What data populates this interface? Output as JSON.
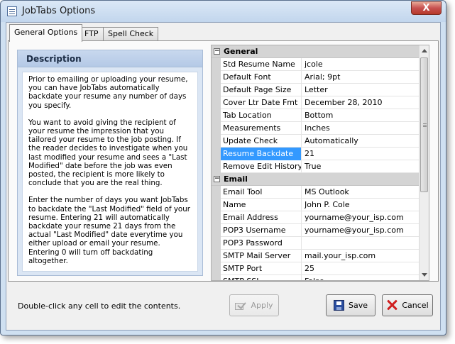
{
  "window": {
    "title": "JobTabs Options",
    "close_label": "X"
  },
  "tabs": [
    {
      "label": "General Options",
      "active": true
    },
    {
      "label": "FTP",
      "active": false
    },
    {
      "label": "Spell Check",
      "active": false
    }
  ],
  "description": {
    "header": "Description",
    "paragraphs": [
      "Prior to emailing or uploading your resume, you can have JobTabs automatically backdate your resume any number of days you specify.",
      "You want to avoid giving the recipient of your resume the impression that you tailored your resume to the job posting.  If the reader decides to investigate when you last modified your resume and sees a \"Last Modified\" date before the job was even posted, the recipient is more likely to conclude that you are the real thing.",
      "Enter the number of days you want JobTabs to backdate the \"Last Modified\" field of your resume. Entering 21 will automatically backdate your resume 21 days from the actual \"Last Modified\" date everytime you either upload or email your resume.  Entering 0 will turn off backdating altogether."
    ]
  },
  "grid": {
    "categories": [
      {
        "name": "General",
        "toggle": "−",
        "rows": [
          {
            "name": "Std Resume Name",
            "value": "jcole"
          },
          {
            "name": "Default Font",
            "value": "Arial; 9pt"
          },
          {
            "name": "Default Page Size",
            "value": "Letter"
          },
          {
            "name": "Cover Ltr Date Fmt",
            "value": "December 28, 2010"
          },
          {
            "name": "Tab Location",
            "value": "Bottom"
          },
          {
            "name": "Measurements",
            "value": "Inches"
          },
          {
            "name": "Update Check",
            "value": "Automatically"
          },
          {
            "name": "Resume Backdate",
            "value": "21",
            "selected": true
          },
          {
            "name": "Remove Edit History",
            "value": "True"
          }
        ]
      },
      {
        "name": "Email",
        "toggle": "−",
        "rows": [
          {
            "name": "Email Tool",
            "value": "MS Outlook"
          },
          {
            "name": "Name",
            "value": "John P. Cole"
          },
          {
            "name": "Email Address",
            "value": "yourname@your_isp.com"
          },
          {
            "name": "POP3 Username",
            "value": "yourname@your_isp.com"
          },
          {
            "name": "POP3 Password",
            "value": ""
          },
          {
            "name": "SMTP Mail Server",
            "value": "mail.your_isp.com"
          },
          {
            "name": "SMTP Port",
            "value": "25"
          },
          {
            "name": "SMTP SSL",
            "value": "False"
          }
        ]
      }
    ]
  },
  "footer": {
    "hint": "Double-click any cell to edit the contents.",
    "apply_label": "Apply",
    "save_label": "Save",
    "cancel_label": "Cancel"
  }
}
